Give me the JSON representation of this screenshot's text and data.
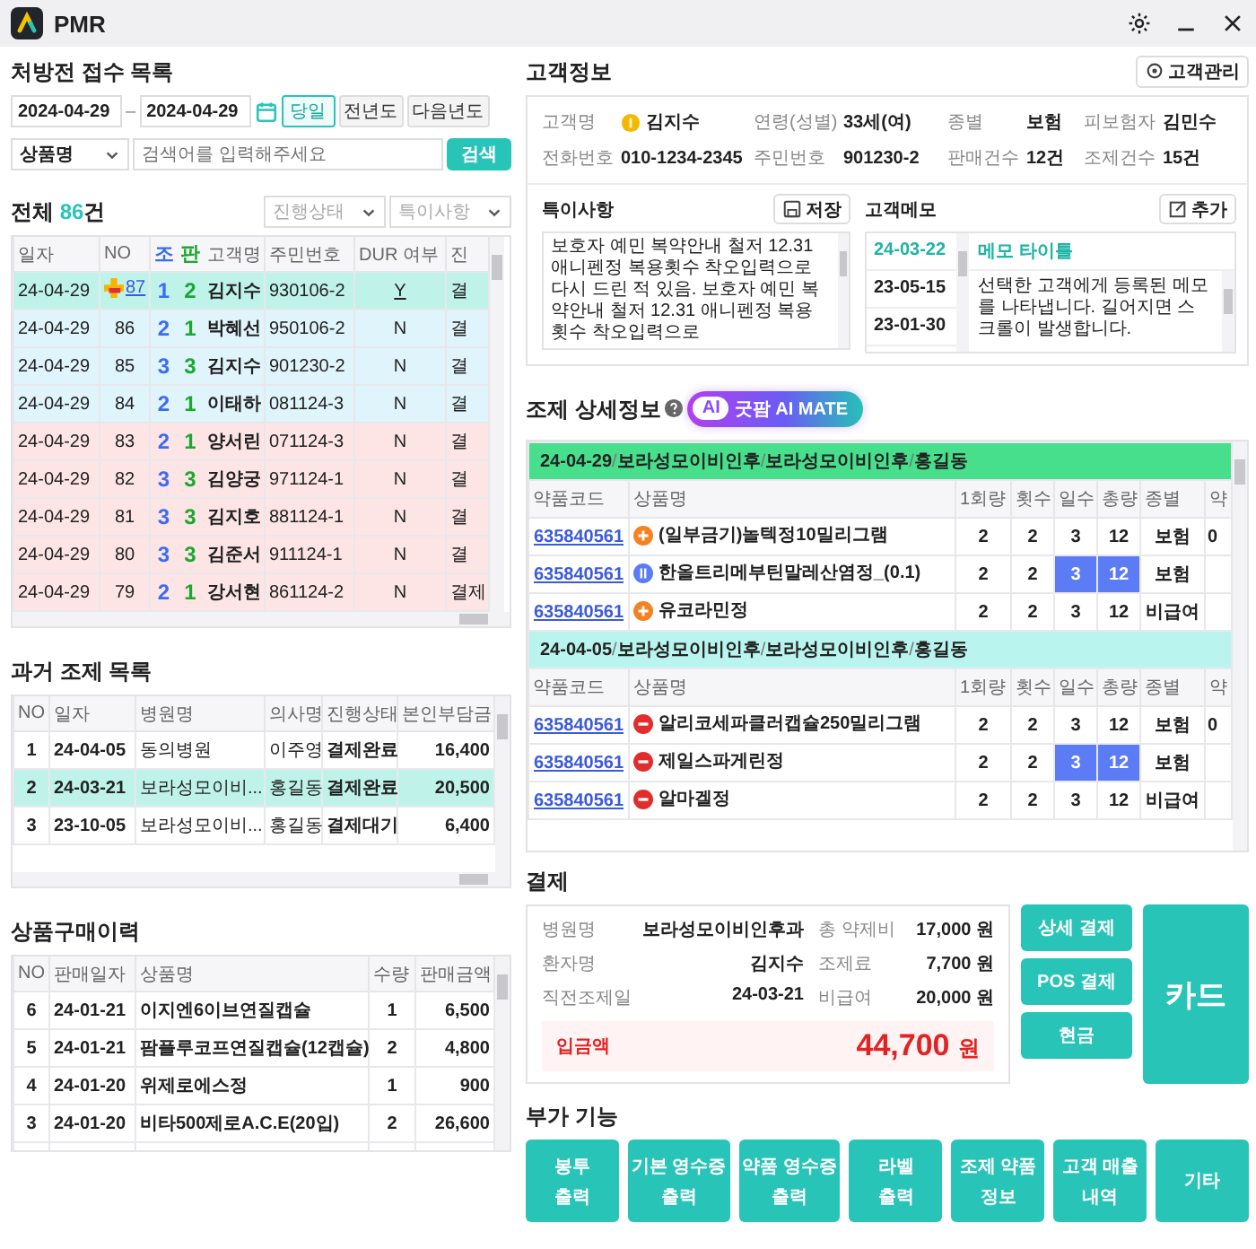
{
  "app": {
    "title": "PMR"
  },
  "reception": {
    "title": "처방전 접수 목록",
    "date_from": "2024-04-29",
    "date_separator": "–",
    "date_to": "2024-04-29",
    "period_buttons": [
      {
        "label": "당일",
        "selected": true
      },
      {
        "label": "전년도",
        "selected": false
      },
      {
        "label": "다음년도",
        "selected": false
      }
    ],
    "search_type": "상품명",
    "search_placeholder": "검색어를 입력해주세요",
    "search_button": "검색",
    "total_prefix": "전체",
    "total_count": "86",
    "total_suffix": "건",
    "filters": [
      {
        "placeholder": "진행상태"
      },
      {
        "placeholder": "특이사항"
      }
    ],
    "columns": [
      {
        "label": "일자",
        "kind": "text"
      },
      {
        "label": "NO",
        "kind": "text"
      },
      {
        "label": "조",
        "kind": "jo"
      },
      {
        "label": "판",
        "kind": "pan"
      },
      {
        "label": "고객명",
        "kind": "text"
      },
      {
        "label": "주민번호",
        "kind": "text"
      },
      {
        "label": "DUR 여부",
        "kind": "text"
      },
      {
        "label": "진",
        "kind": "text"
      }
    ],
    "rows": [
      {
        "date": "24-04-29",
        "no": "87",
        "dur_alert": true,
        "jo": "1",
        "pan": "2",
        "name": "김지수",
        "rrn": "930106-2",
        "dur": "Y",
        "status": "결",
        "selected": true
      },
      {
        "date": "24-04-29",
        "no": "86",
        "dur_alert": false,
        "jo": "2",
        "pan": "1",
        "name": "박혜선",
        "rrn": "950106-2",
        "dur": "N",
        "status": "결",
        "selected": false,
        "color": "#e0f4fb"
      },
      {
        "date": "24-04-29",
        "no": "85",
        "dur_alert": false,
        "jo": "3",
        "pan": "3",
        "name": "김지수",
        "rrn": "901230-2",
        "dur": "N",
        "status": "결",
        "selected": false,
        "color": "#e0f4fb"
      },
      {
        "date": "24-04-29",
        "no": "84",
        "dur_alert": false,
        "jo": "2",
        "pan": "1",
        "name": "이태하",
        "rrn": "081124-3",
        "dur": "N",
        "status": "결",
        "selected": false,
        "color": "#e0f4fb"
      },
      {
        "date": "24-04-29",
        "no": "83",
        "dur_alert": false,
        "jo": "2",
        "pan": "1",
        "name": "양서린",
        "rrn": "071124-3",
        "dur": "N",
        "status": "결",
        "selected": false,
        "color": "#fde4e5"
      },
      {
        "date": "24-04-29",
        "no": "82",
        "dur_alert": false,
        "jo": "3",
        "pan": "3",
        "name": "김양궁",
        "rrn": "971124-1",
        "dur": "N",
        "status": "결",
        "selected": false,
        "color": "#fde4e5"
      },
      {
        "date": "24-04-29",
        "no": "81",
        "dur_alert": false,
        "jo": "3",
        "pan": "3",
        "name": "김지호",
        "rrn": "881124-1",
        "dur": "N",
        "status": "결",
        "selected": false,
        "color": "#fde4e5"
      },
      {
        "date": "24-04-29",
        "no": "80",
        "dur_alert": false,
        "jo": "3",
        "pan": "3",
        "name": "김준서",
        "rrn": "911124-1",
        "dur": "N",
        "status": "결",
        "selected": false,
        "color": "#fde4e5"
      },
      {
        "date": "24-04-29",
        "no": "79",
        "dur_alert": false,
        "jo": "2",
        "pan": "1",
        "name": "강서현",
        "rrn": "861124-2",
        "dur": "N",
        "status": "결제",
        "selected": false,
        "color": "#fde4e5"
      }
    ]
  },
  "past": {
    "title": "과거 조제 목록",
    "columns": [
      "NO",
      "일자",
      "병원명",
      "의사명",
      "진행상태",
      "본인부담금"
    ],
    "rows": [
      {
        "no": "1",
        "date": "24-04-05",
        "hospital": "동의병원",
        "doctor": "이주영",
        "status": "결제완료",
        "amount": "16,400",
        "selected": false
      },
      {
        "no": "2",
        "date": "24-03-21",
        "hospital": "보라성모이비...",
        "doctor": "홍길동",
        "status": "결제완료",
        "amount": "20,500",
        "selected": true
      },
      {
        "no": "3",
        "date": "23-10-05",
        "hospital": "보라성모이비...",
        "doctor": "홍길동",
        "status": "결제대기",
        "amount": "6,400",
        "selected": false
      }
    ]
  },
  "purchases": {
    "title": "상품구매이력",
    "columns": [
      "NO",
      "판매일자",
      "상품명",
      "수량",
      "판매금액"
    ],
    "rows": [
      {
        "no": "6",
        "date": "24-01-21",
        "product": "이지엔6이브연질캡슐",
        "qty": "1",
        "amount": "6,500"
      },
      {
        "no": "5",
        "date": "24-01-21",
        "product": "팜플루코프연질캡슐(12캡슐)",
        "qty": "2",
        "amount": "4,800"
      },
      {
        "no": "4",
        "date": "24-01-20",
        "product": "위제로에스정",
        "qty": "1",
        "amount": "900"
      },
      {
        "no": "3",
        "date": "24-01-20",
        "product": "비타500제로A.C.E(20입)",
        "qty": "2",
        "amount": "26,600"
      }
    ]
  },
  "customer": {
    "title": "고객정보",
    "manage_button": "고객관리",
    "fields": [
      {
        "label": "고객명",
        "value": "김지수",
        "coin_badge": true
      },
      {
        "label": "연령(성별)",
        "value": "33세(여)",
        "coin_badge": false
      },
      {
        "label": "종별",
        "value": "보험",
        "coin_badge": false
      },
      {
        "label": "피보험자",
        "value": "김민수",
        "coin_badge": false
      },
      {
        "label": "전화번호",
        "value": "010-1234-2345",
        "coin_badge": false
      },
      {
        "label": "주민번호",
        "value": "901230-2",
        "coin_badge": false
      },
      {
        "label": "판매건수",
        "value": "12건",
        "coin_badge": false
      },
      {
        "label": "조제건수",
        "value": "15건",
        "coin_badge": false
      }
    ],
    "notes_title": "특이사항",
    "save_button": "저장",
    "notes": "보호자 예민 복약안내 철저 12.31 애니펜정 복용횟수 착오입력으로 다시 드린 적 있음. 보호자 예민 복약안내 철저 12.31 애니펜정 복용횟수 착오입력으로",
    "memo_title": "고객메모",
    "add_button": "추가",
    "memo_dates": [
      {
        "label": "24-03-22",
        "selected": true
      },
      {
        "label": "23-05-15",
        "selected": false
      },
      {
        "label": "23-01-30",
        "selected": false
      }
    ],
    "memo_heading": "메모 타이틀",
    "memo_body": "선택한 고객에게 등록된 메모를 나타냅니다. 길어지면 스크롤이 발생합니다."
  },
  "detail": {
    "title": "조제 상세정보",
    "ai_tag": "AI",
    "ai_label": "굿팜 AI MATE",
    "separator": "/",
    "groups": [
      {
        "color": "#47df8c",
        "segments": [
          "24-04-29",
          "보라성모이비인후",
          "보라성모이비인후",
          "홍길동"
        ],
        "columns": [
          "약품코드",
          "상품명",
          "1회량",
          "횟수",
          "일수",
          "총량",
          "종별",
          "약"
        ],
        "rows": [
          {
            "code": "635840561",
            "kind": "plus",
            "name": "(일부금기)놀텍정10밀리그램",
            "dose": "2",
            "times": "2",
            "days": "3",
            "total": "12",
            "highlight": false,
            "type": "보험",
            "extra": "0"
          },
          {
            "code": "635840561",
            "kind": "bars",
            "name": "한올트리메부틴말레산염정_(0.1)",
            "dose": "2",
            "times": "2",
            "days": "3",
            "total": "12",
            "highlight": true,
            "type": "보험"
          },
          {
            "code": "635840561",
            "kind": "plus",
            "name": "유코라민정",
            "dose": "2",
            "times": "2",
            "days": "3",
            "total": "12",
            "highlight": false,
            "type": "비급여"
          }
        ]
      },
      {
        "color": "#b9f4ee",
        "segments": [
          "24-04-05",
          "보라성모이비인후",
          "보라성모이비인후",
          "홍길동"
        ],
        "columns": [
          "약품코드",
          "상품명",
          "1회량",
          "횟수",
          "일수",
          "총량",
          "종별",
          "약"
        ],
        "rows": [
          {
            "code": "635840561",
            "kind": "minus",
            "name": "알리코세파클러캡슐250밀리그램",
            "dose": "2",
            "times": "2",
            "days": "3",
            "total": "12",
            "highlight": false,
            "type": "보험",
            "extra": "0"
          },
          {
            "code": "635840561",
            "kind": "minus",
            "name": "제일스파게린정",
            "dose": "2",
            "times": "2",
            "days": "3",
            "total": "12",
            "highlight": true,
            "type": "보험"
          },
          {
            "code": "635840561",
            "kind": "minus",
            "name": "알마겔정",
            "dose": "2",
            "times": "2",
            "days": "3",
            "total": "12",
            "highlight": false,
            "type": "비급여"
          }
        ]
      }
    ]
  },
  "payment": {
    "title": "결제",
    "left": [
      {
        "label": "병원명",
        "value": "보라성모이비인후과"
      },
      {
        "label": "환자명",
        "value": "김지수"
      },
      {
        "label": "직전조제일",
        "value": "24-03-21"
      }
    ],
    "right": [
      {
        "label": "총 약제비",
        "value": "17,000",
        "unit": "원"
      },
      {
        "label": "조제료",
        "value": "7,700",
        "unit": "원"
      },
      {
        "label": "비급여",
        "value": "20,000",
        "unit": "원"
      }
    ],
    "deposit": {
      "label": "입금액",
      "value": "44,700",
      "unit": "원"
    },
    "buttons": [
      "상세 결제",
      "POS 결제",
      "현금"
    ],
    "card_button": "카드"
  },
  "extras": {
    "title": "부가 기능",
    "buttons": [
      {
        "lines": [
          "봉투",
          "출력"
        ]
      },
      {
        "lines": [
          "기본 영수증",
          "출력"
        ]
      },
      {
        "lines": [
          "약품 영수증",
          "출력"
        ]
      },
      {
        "lines": [
          "라벨",
          "출력"
        ]
      },
      {
        "lines": [
          "조제 약품",
          "정보"
        ]
      },
      {
        "lines": [
          "고객 매출",
          "내역"
        ]
      },
      {
        "lines": [
          "기타"
        ]
      }
    ]
  }
}
